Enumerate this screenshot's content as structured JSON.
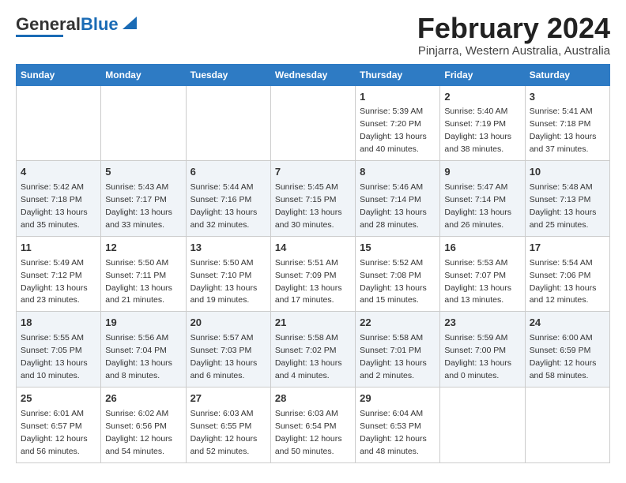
{
  "logo": {
    "general": "General",
    "blue": "Blue"
  },
  "title": "February 2024",
  "subtitle": "Pinjarra, Western Australia, Australia",
  "weekdays": [
    "Sunday",
    "Monday",
    "Tuesday",
    "Wednesday",
    "Thursday",
    "Friday",
    "Saturday"
  ],
  "weeks": [
    [
      {
        "day": "",
        "info": ""
      },
      {
        "day": "",
        "info": ""
      },
      {
        "day": "",
        "info": ""
      },
      {
        "day": "",
        "info": ""
      },
      {
        "day": "1",
        "info": "Sunrise: 5:39 AM\nSunset: 7:20 PM\nDaylight: 13 hours\nand 40 minutes."
      },
      {
        "day": "2",
        "info": "Sunrise: 5:40 AM\nSunset: 7:19 PM\nDaylight: 13 hours\nand 38 minutes."
      },
      {
        "day": "3",
        "info": "Sunrise: 5:41 AM\nSunset: 7:18 PM\nDaylight: 13 hours\nand 37 minutes."
      }
    ],
    [
      {
        "day": "4",
        "info": "Sunrise: 5:42 AM\nSunset: 7:18 PM\nDaylight: 13 hours\nand 35 minutes."
      },
      {
        "day": "5",
        "info": "Sunrise: 5:43 AM\nSunset: 7:17 PM\nDaylight: 13 hours\nand 33 minutes."
      },
      {
        "day": "6",
        "info": "Sunrise: 5:44 AM\nSunset: 7:16 PM\nDaylight: 13 hours\nand 32 minutes."
      },
      {
        "day": "7",
        "info": "Sunrise: 5:45 AM\nSunset: 7:15 PM\nDaylight: 13 hours\nand 30 minutes."
      },
      {
        "day": "8",
        "info": "Sunrise: 5:46 AM\nSunset: 7:14 PM\nDaylight: 13 hours\nand 28 minutes."
      },
      {
        "day": "9",
        "info": "Sunrise: 5:47 AM\nSunset: 7:14 PM\nDaylight: 13 hours\nand 26 minutes."
      },
      {
        "day": "10",
        "info": "Sunrise: 5:48 AM\nSunset: 7:13 PM\nDaylight: 13 hours\nand 25 minutes."
      }
    ],
    [
      {
        "day": "11",
        "info": "Sunrise: 5:49 AM\nSunset: 7:12 PM\nDaylight: 13 hours\nand 23 minutes."
      },
      {
        "day": "12",
        "info": "Sunrise: 5:50 AM\nSunset: 7:11 PM\nDaylight: 13 hours\nand 21 minutes."
      },
      {
        "day": "13",
        "info": "Sunrise: 5:50 AM\nSunset: 7:10 PM\nDaylight: 13 hours\nand 19 minutes."
      },
      {
        "day": "14",
        "info": "Sunrise: 5:51 AM\nSunset: 7:09 PM\nDaylight: 13 hours\nand 17 minutes."
      },
      {
        "day": "15",
        "info": "Sunrise: 5:52 AM\nSunset: 7:08 PM\nDaylight: 13 hours\nand 15 minutes."
      },
      {
        "day": "16",
        "info": "Sunrise: 5:53 AM\nSunset: 7:07 PM\nDaylight: 13 hours\nand 13 minutes."
      },
      {
        "day": "17",
        "info": "Sunrise: 5:54 AM\nSunset: 7:06 PM\nDaylight: 13 hours\nand 12 minutes."
      }
    ],
    [
      {
        "day": "18",
        "info": "Sunrise: 5:55 AM\nSunset: 7:05 PM\nDaylight: 13 hours\nand 10 minutes."
      },
      {
        "day": "19",
        "info": "Sunrise: 5:56 AM\nSunset: 7:04 PM\nDaylight: 13 hours\nand 8 minutes."
      },
      {
        "day": "20",
        "info": "Sunrise: 5:57 AM\nSunset: 7:03 PM\nDaylight: 13 hours\nand 6 minutes."
      },
      {
        "day": "21",
        "info": "Sunrise: 5:58 AM\nSunset: 7:02 PM\nDaylight: 13 hours\nand 4 minutes."
      },
      {
        "day": "22",
        "info": "Sunrise: 5:58 AM\nSunset: 7:01 PM\nDaylight: 13 hours\nand 2 minutes."
      },
      {
        "day": "23",
        "info": "Sunrise: 5:59 AM\nSunset: 7:00 PM\nDaylight: 13 hours\nand 0 minutes."
      },
      {
        "day": "24",
        "info": "Sunrise: 6:00 AM\nSunset: 6:59 PM\nDaylight: 12 hours\nand 58 minutes."
      }
    ],
    [
      {
        "day": "25",
        "info": "Sunrise: 6:01 AM\nSunset: 6:57 PM\nDaylight: 12 hours\nand 56 minutes."
      },
      {
        "day": "26",
        "info": "Sunrise: 6:02 AM\nSunset: 6:56 PM\nDaylight: 12 hours\nand 54 minutes."
      },
      {
        "day": "27",
        "info": "Sunrise: 6:03 AM\nSunset: 6:55 PM\nDaylight: 12 hours\nand 52 minutes."
      },
      {
        "day": "28",
        "info": "Sunrise: 6:03 AM\nSunset: 6:54 PM\nDaylight: 12 hours\nand 50 minutes."
      },
      {
        "day": "29",
        "info": "Sunrise: 6:04 AM\nSunset: 6:53 PM\nDaylight: 12 hours\nand 48 minutes."
      },
      {
        "day": "",
        "info": ""
      },
      {
        "day": "",
        "info": ""
      }
    ]
  ]
}
